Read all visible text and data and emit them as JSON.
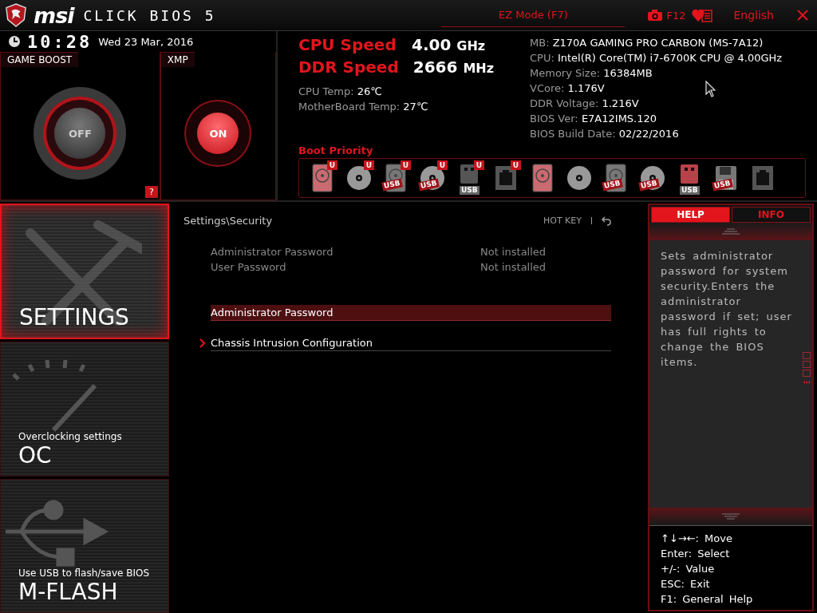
{
  "header": {
    "logo": "msi",
    "product": "CLICK BIOS 5",
    "mode_button": "EZ Mode (F7)",
    "screenshot_key": "F12",
    "language": "English"
  },
  "clock": {
    "time": "10:28",
    "date": "Wed  23 Mar, 2016"
  },
  "boost_panels": [
    {
      "kind": "game_boost",
      "title": "GAME BOOST",
      "on": false,
      "label": "OFF",
      "help": "?"
    },
    {
      "kind": "xmp",
      "title": "XMP",
      "on": true,
      "label": "ON"
    }
  ],
  "speeds": [
    {
      "label": "CPU Speed",
      "value": "4.00",
      "unit": "GHz"
    },
    {
      "label": "DDR Speed",
      "value": "2666",
      "unit": "MHz"
    }
  ],
  "temps": [
    {
      "label": "CPU Temp:",
      "value": "26℃"
    },
    {
      "label": "MotherBoard Temp:",
      "value": "27℃"
    }
  ],
  "system_info": [
    {
      "label": "MB:",
      "value": "Z170A GAMING PRO CARBON (MS-7A12)"
    },
    {
      "label": "CPU:",
      "value": "Intel(R) Core(TM) i7-6700K CPU @ 4.00GHz"
    },
    {
      "label": "Memory Size:",
      "value": "16384MB"
    },
    {
      "label": "VCore:",
      "value": "1.176V"
    },
    {
      "label": "DDR Voltage:",
      "value": "1.216V"
    },
    {
      "label": "BIOS Ver:",
      "value": "E7A12IMS.120"
    },
    {
      "label": "BIOS Build Date:",
      "value": "02/22/2016"
    }
  ],
  "boot_priority": {
    "title": "Boot Priority",
    "devices": [
      {
        "kind": "hdd",
        "badge": "U"
      },
      {
        "kind": "disc",
        "badge": "U"
      },
      {
        "kind": "hdd",
        "badge": "U",
        "label": "USB"
      },
      {
        "kind": "disc",
        "badge": "U",
        "label": "USB"
      },
      {
        "kind": "usb-key",
        "badge": "U",
        "label": "USB"
      },
      {
        "kind": "network",
        "badge": "U"
      },
      {
        "kind": "hdd"
      },
      {
        "kind": "disc"
      },
      {
        "kind": "hdd",
        "label": "USB"
      },
      {
        "kind": "disc",
        "label": "USB"
      },
      {
        "kind": "usb-key",
        "label": "USB"
      },
      {
        "kind": "floppy",
        "label": "USB"
      },
      {
        "kind": "network"
      }
    ]
  },
  "menu": [
    {
      "kind": "settings",
      "title": "SETTINGS",
      "selected": true
    },
    {
      "kind": "oc",
      "subtitle": "Overclocking settings",
      "title": "OC",
      "selected": false
    },
    {
      "kind": "mflash",
      "subtitle": "Use USB to flash/save BIOS",
      "title": "M-FLASH",
      "selected": false
    }
  ],
  "content": {
    "breadcrumb": "Settings\\Security",
    "hotkey": "HOT KEY",
    "info_rows": [
      {
        "label": "Administrator Password",
        "value": "Not installed"
      },
      {
        "label": "User Password",
        "value": "Not installed"
      }
    ],
    "items": [
      {
        "label": "Administrator Password",
        "selected": true,
        "submenu": false
      },
      {
        "label": "Chassis Intrusion Configuration",
        "selected": false,
        "submenu": true
      }
    ]
  },
  "side_panel": {
    "tabs": [
      {
        "label": "HELP",
        "selected": true
      },
      {
        "label": "INFO",
        "selected": false
      }
    ],
    "help_text": "Sets administrator password for system security.Enters the administrator password if set; user has full rights to change the BIOS items.",
    "keys": [
      {
        "key": "↑↓→←:",
        "action": "Move"
      },
      {
        "key": "Enter:",
        "action": "Select"
      },
      {
        "key": "+/-:",
        "action": "Value"
      },
      {
        "key": "ESC:",
        "action": "Exit"
      },
      {
        "key": "F1:",
        "action": "General Help"
      }
    ]
  }
}
